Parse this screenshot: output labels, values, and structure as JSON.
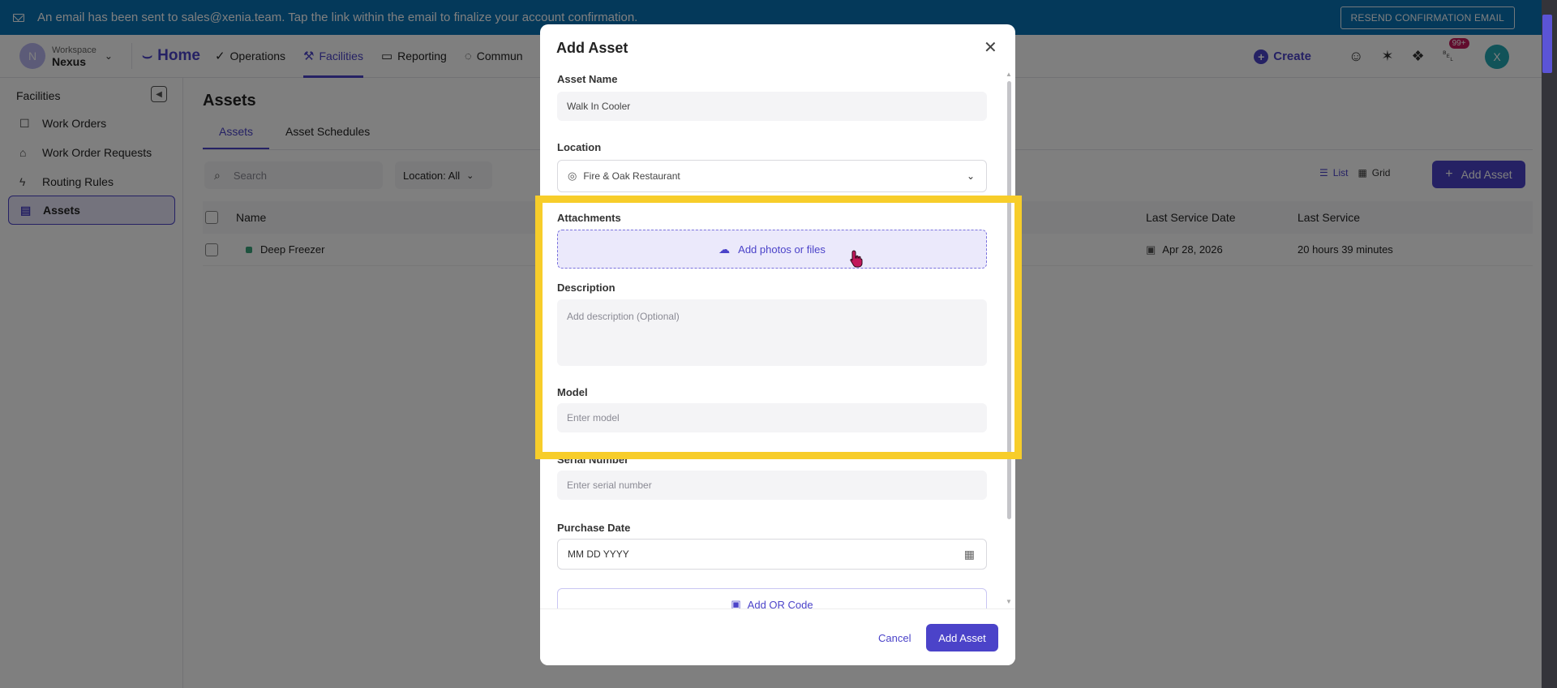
{
  "banner": {
    "message": "An email has been sent to sales@xenia.team. Tap the link within the email to finalize your account confirmation.",
    "resend_label": "RESEND CONFIRMATION EMAIL"
  },
  "workspace": {
    "initial": "N",
    "label": "Workspace",
    "name": "Nexus"
  },
  "nav": {
    "home": "Home",
    "items": [
      {
        "label": "Operations",
        "icon": "check-circle-icon"
      },
      {
        "label": "Facilities",
        "icon": "tools-icon"
      },
      {
        "label": "Reporting",
        "icon": "monitor-icon"
      },
      {
        "label": "Commun",
        "icon": "chat-icon"
      }
    ],
    "create": "Create",
    "notif_badge": "99+",
    "user_initial": "X"
  },
  "sidebar": {
    "heading": "Facilities",
    "items": [
      {
        "label": "Work Orders",
        "icon": "clipboard-icon"
      },
      {
        "label": "Work Order Requests",
        "icon": "inbox-icon"
      },
      {
        "label": "Routing Rules",
        "icon": "lightning-icon"
      },
      {
        "label": "Assets",
        "icon": "assets-icon"
      }
    ]
  },
  "main": {
    "title": "Assets",
    "tabs": [
      "Assets",
      "Asset Schedules"
    ],
    "search_placeholder": "Search",
    "location_filter": "Location: All",
    "view_list": "List",
    "view_grid": "Grid",
    "add_button": "Add Asset",
    "columns": [
      "Name",
      "Last Service Date",
      "Last Service"
    ],
    "rows": [
      {
        "name": "Deep Freezer",
        "last_service_date": "Apr 28, 2026",
        "last_service": "20 hours 39 minutes"
      }
    ]
  },
  "modal": {
    "title": "Add Asset",
    "asset_name_label": "Asset Name",
    "asset_name_value": "Walk In Cooler",
    "location_label": "Location",
    "location_value": "Fire & Oak Restaurant",
    "attachments_label": "Attachments",
    "attachments_cta": "Add photos or files",
    "description_label": "Description",
    "description_placeholder": "Add description (Optional)",
    "model_label": "Model",
    "model_placeholder": "Enter model",
    "serial_label": "Serial Number",
    "serial_placeholder": "Enter serial number",
    "purchase_label": "Purchase Date",
    "purchase_placeholder": "MM DD YYYY",
    "qr_label": "Add QR Code",
    "cancel_label": "Cancel",
    "submit_label": "Add Asset"
  },
  "colors": {
    "banner": "#0873b5",
    "accent": "#4b43c9",
    "highlight": "#f7cd2a",
    "cursor": "#c2185b"
  }
}
